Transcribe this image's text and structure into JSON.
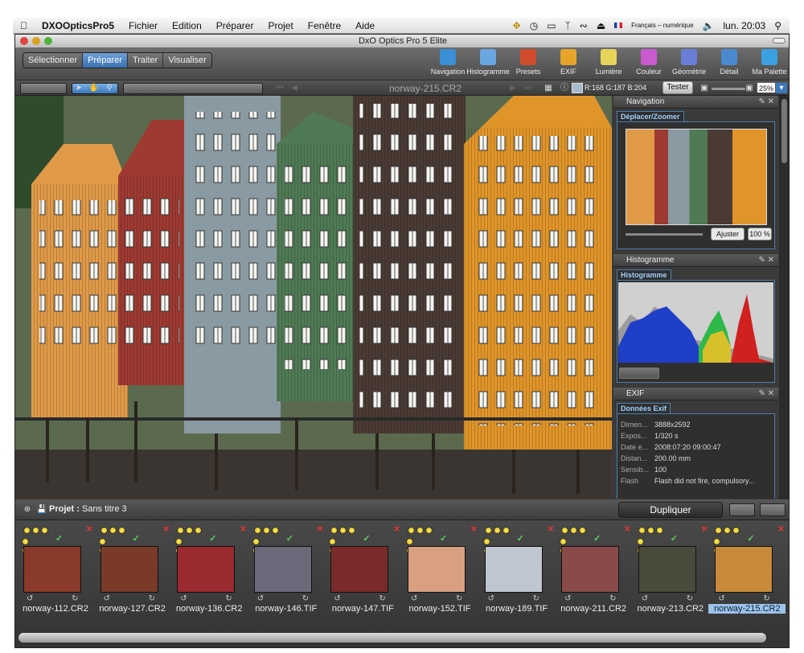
{
  "menubar": {
    "app": "DXOOpticsPro5",
    "items": [
      "Fichier",
      "Edition",
      "Préparer",
      "Projet",
      "Fenêtre",
      "Aide"
    ],
    "lang": "Français – numérique",
    "clock": "lun. 20:03"
  },
  "window": {
    "title": "DxO Optics Pro 5 Elite"
  },
  "modes": [
    "Sélectionner",
    "Préparer",
    "Traiter",
    "Visualiser"
  ],
  "tools": [
    {
      "label": "Navigation",
      "color": "#3a8fd6"
    },
    {
      "label": "Histogramme",
      "color": "#6aa6e0"
    },
    {
      "label": "Presets",
      "color": "#d04c2c"
    },
    {
      "label": "EXIF",
      "color": "#e6a52a"
    },
    {
      "label": "Lumière",
      "color": "#e6d35a"
    },
    {
      "label": "Couleur",
      "color": "#c95ad0"
    },
    {
      "label": "Géométrie",
      "color": "#6a7ed8"
    },
    {
      "label": "Détail",
      "color": "#4a8ad0"
    },
    {
      "label": "Ma Palette",
      "color": "#3aa0e0"
    }
  ],
  "viewer": {
    "filename": "norway-215.CR2",
    "rgb": "R:168  G:187  B:204",
    "tester": "Tester",
    "zoom": "25%"
  },
  "panels": {
    "navigation": {
      "title": "Navigation",
      "tab": "Déplacer/Zoomer",
      "fit": "Ajuster",
      "zoom100": "100 %"
    },
    "histogram": {
      "title": "Histogramme",
      "tab": "Histogramme"
    },
    "exif": {
      "title": "EXIF",
      "tab": "Données Exif",
      "rows": [
        {
          "k": "Dimen...",
          "v": "3888x2592"
        },
        {
          "k": "Expos...",
          "v": "1/320 s"
        },
        {
          "k": "Date e...",
          "v": "2008:07:20 09:00:47"
        },
        {
          "k": "Distan...",
          "v": "200.00 mm"
        },
        {
          "k": "Sensib...",
          "v": "100"
        },
        {
          "k": "Flash",
          "v": "Flash did not fire, compulsory..."
        }
      ]
    }
  },
  "project": {
    "label": "Projet :",
    "name": "Sans titre 3",
    "duplicate": "Dupliquer"
  },
  "thumbnails": [
    {
      "name": "norway-112.CR2",
      "color": "#8a3a2a"
    },
    {
      "name": "norway-127.CR2",
      "color": "#7a3a2a"
    },
    {
      "name": "norway-136.CR2",
      "color": "#9a2a30"
    },
    {
      "name": "norway-146.TIF",
      "color": "#6a6a7a"
    },
    {
      "name": "norway-147.TIF",
      "color": "#7a2a2a"
    },
    {
      "name": "norway-152.TIF",
      "color": "#d8a080"
    },
    {
      "name": "norway-189.TIF",
      "color": "#c0c6d0"
    },
    {
      "name": "norway-211.CR2",
      "color": "#8a4a4a"
    },
    {
      "name": "norway-213.CR2",
      "color": "#4a4a3a"
    },
    {
      "name": "norway-215.CR2",
      "color": "#c88a3a"
    }
  ]
}
